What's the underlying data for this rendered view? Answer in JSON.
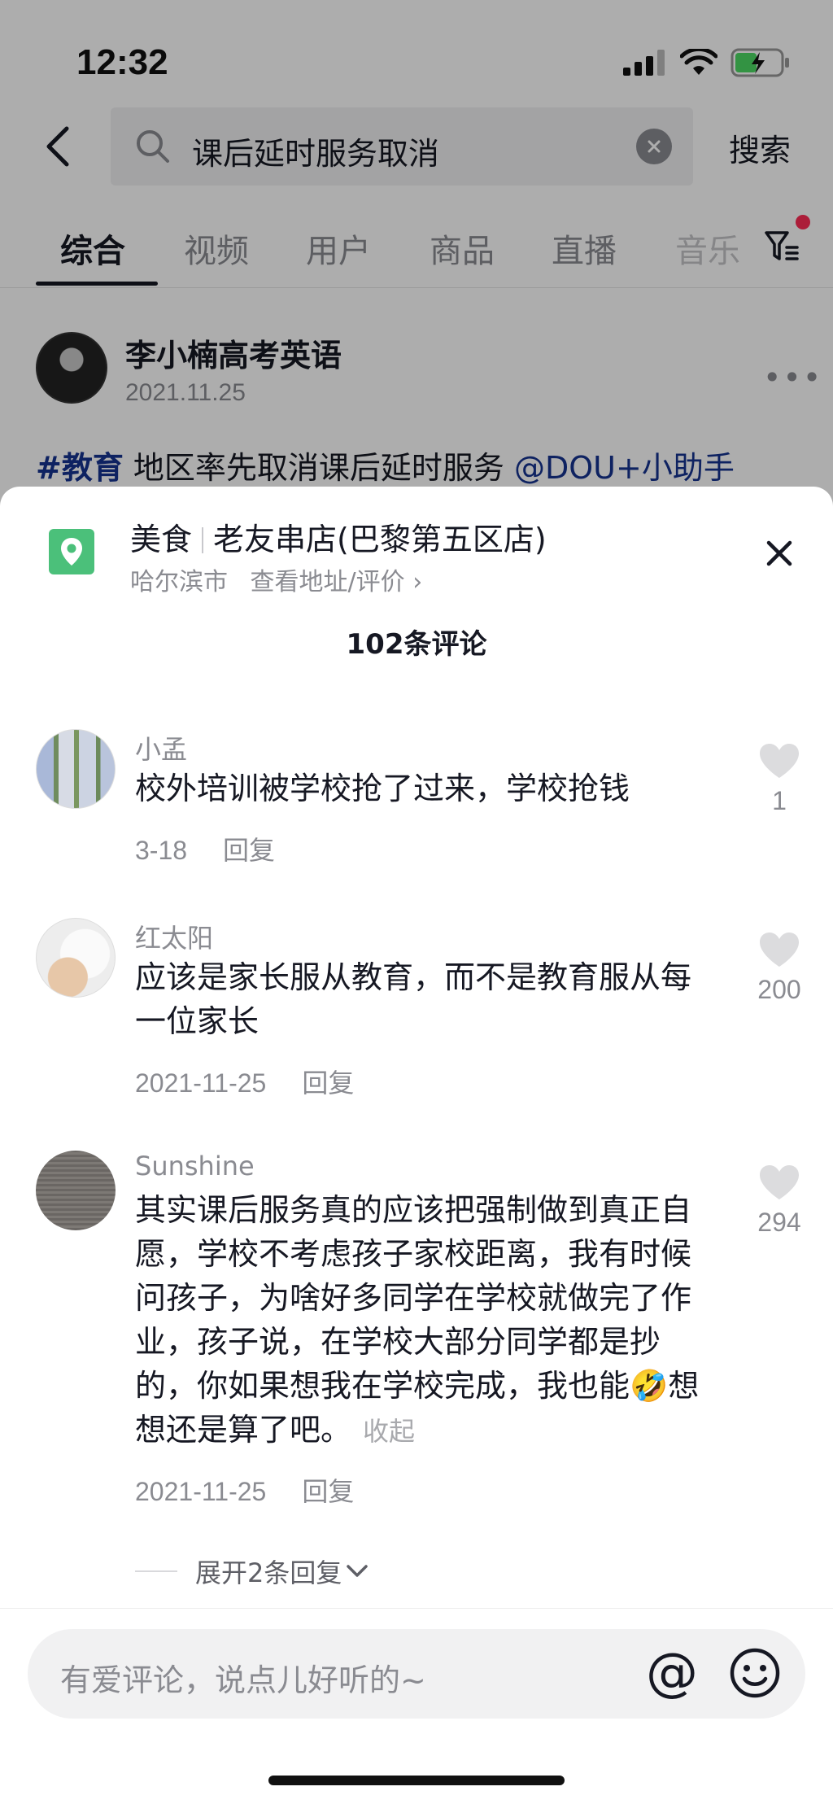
{
  "status_bar": {
    "time": "12:32"
  },
  "search": {
    "query": "课后延时服务取消",
    "submit_label": "搜索"
  },
  "tabs": [
    {
      "label": "综合",
      "active": true
    },
    {
      "label": "视频",
      "active": false
    },
    {
      "label": "用户",
      "active": false
    },
    {
      "label": "商品",
      "active": false
    },
    {
      "label": "直播",
      "active": false
    },
    {
      "label": "音乐",
      "active": false
    }
  ],
  "post": {
    "author": "李小楠高考英语",
    "date": "2021.11.25",
    "caption_tag": "#教育",
    "caption_text": " 地区率先取消课后延时服务 ",
    "caption_mention": "@DOU+小助手"
  },
  "poi": {
    "category": "美食",
    "name": "老友串店(巴黎第五区店)",
    "city": "哈尔滨市",
    "link_label": "查看地址/评价 ›"
  },
  "comments_header": {
    "count_label": "102条评论"
  },
  "comments": [
    {
      "user": "小孟",
      "text": "校外培训被学校抢了过来，学校抢钱",
      "date": "3-18",
      "reply_label": "回复",
      "likes": "1"
    },
    {
      "user": "红太阳",
      "text": "应该是家长服从教育，而不是教育服从每一位家长",
      "date": "2021-11-25",
      "reply_label": "回复",
      "likes": "200"
    },
    {
      "user": "Sunshine",
      "text_before_emoji": "其实课后服务真的应该把强制做到真正自愿，学校不考虑孩子家校距离，我有时候问孩子，为啥好多同学在学校就做完了作业，孩子说，在学校大部分同学都是抄的，你如果想我在学校完成，我也能",
      "emoji": "🤣",
      "text_after_emoji": "想想还是算了吧。",
      "collapse_label": "收起",
      "date": "2021-11-25",
      "reply_label": "回复",
      "likes": "294"
    }
  ],
  "expand_replies": {
    "label": "展开2条回复"
  },
  "comment_input": {
    "placeholder": "有爱评论，说点儿好听的~",
    "at_symbol": "@"
  },
  "colors": {
    "accent_red": "#fe2c55",
    "poi_green": "#4bc07a",
    "hashtag_blue": "#16338f"
  }
}
